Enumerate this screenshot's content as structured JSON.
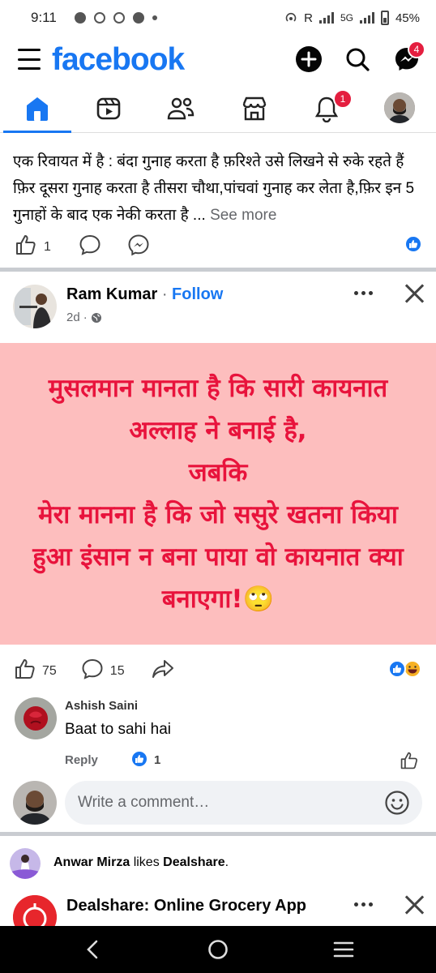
{
  "status_bar": {
    "time": "9:11",
    "network_label": "R",
    "network_type": "5G",
    "battery": "45%"
  },
  "header": {
    "logo": "facebook",
    "messenger_badge": "4"
  },
  "tabs": {
    "notifications_badge": "1"
  },
  "post1": {
    "text": "एक रिवायत में है : बंदा गुनाह करता है फ़रिश्ते उसे लिखने से रुके रहते हैं फ़िर दूसरा गुनाह करता है तीसरा चौथा,पांचवां गुनाह कर लेता है,फ़िर इन 5 गुनाहों के बाद एक नेकी करता है ...",
    "see_more": "See more",
    "like_count": "1"
  },
  "post2": {
    "author": "Ram Kumar",
    "separator": " · ",
    "follow": "Follow",
    "time": "2d",
    "separator2": " · ",
    "image_text": "मुसलमान मानता है कि सारी कायनात अल्लाह ने बनाई है,\nजबकि\nमेरा मानना है कि जो ससुरे खतना किया हुआ इंसान न बना पाया वो कायनात क्या बनाएगा!🙄",
    "like_count": "75",
    "comment_count": "15",
    "comment": {
      "author": "Ashish Saini",
      "text": "Baat to sahi hai",
      "reply_label": "Reply",
      "like_count": "1"
    },
    "write_placeholder": "Write a comment…"
  },
  "activity": {
    "actor": "Anwar Mirza",
    "verb": " likes ",
    "object": "Dealshare",
    "end": "."
  },
  "post3": {
    "title": "Dealshare: Online Grocery App"
  },
  "colors": {
    "brand": "#1877f2",
    "badge": "#e41e3f",
    "image_bg": "#fdbebe",
    "image_text": "#e8133c"
  }
}
